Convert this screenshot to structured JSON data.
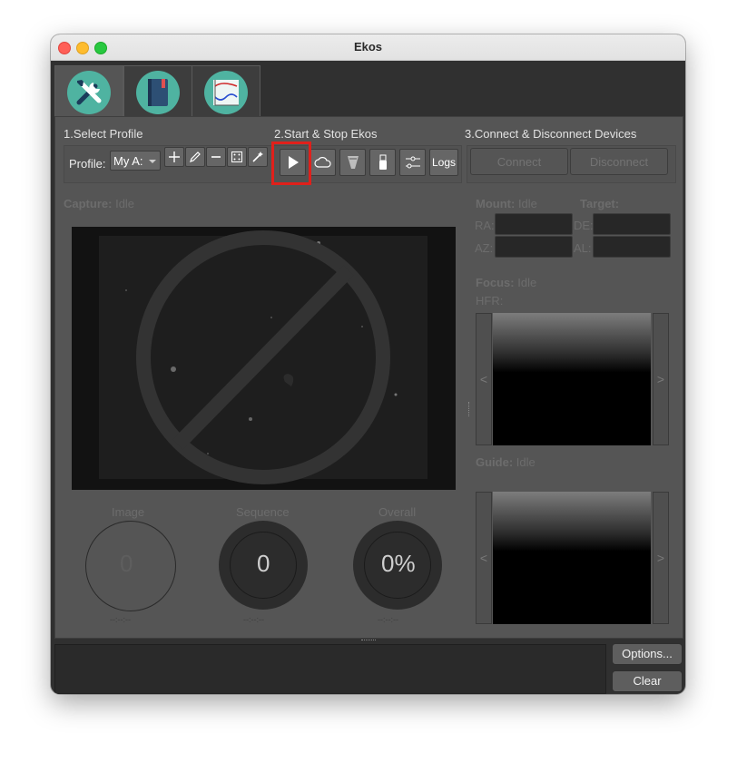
{
  "window": {
    "title": "Ekos"
  },
  "tabs": [
    {
      "icon": "tools-icon",
      "active": true
    },
    {
      "icon": "notebook-icon",
      "active": false
    },
    {
      "icon": "analyze-chart-icon",
      "active": false
    }
  ],
  "sections": {
    "profile": "1.Select Profile",
    "start_stop": "2.Start & Stop Ekos",
    "connect": "3.Connect & Disconnect Devices"
  },
  "profile": {
    "label": "Profile:",
    "selected": "My A:",
    "buttons": [
      "add-icon",
      "edit-icon",
      "remove-icon",
      "dice-icon",
      "wand-icon"
    ]
  },
  "start_stop": {
    "buttons": [
      "play-icon",
      "cloud-icon",
      "telescope-icon",
      "usb-icon",
      "settings-sliders-icon"
    ],
    "logs_label": "Logs"
  },
  "connect": {
    "connect_label": "Connect",
    "disconnect_label": "Disconnect"
  },
  "capture": {
    "label": "Capture:",
    "status": "Idle"
  },
  "mount": {
    "label": "Mount:",
    "status": "Idle",
    "target_label": "Target:",
    "ra": "RA:",
    "de": "DE:",
    "az": "AZ:",
    "al": "AL:"
  },
  "focus": {
    "label": "Focus:",
    "status": "Idle",
    "hfr": "HFR:"
  },
  "guide": {
    "label": "Guide:",
    "status": "Idle"
  },
  "progress": {
    "image": {
      "label": "Image",
      "value": "0",
      "time": "--:--:--"
    },
    "sequence": {
      "label": "Sequence",
      "value": "0",
      "time": "--:--:--"
    },
    "overall": {
      "label": "Overall",
      "value": "0%",
      "time": "--:--:--"
    }
  },
  "nav": {
    "left": "<",
    "right": ">"
  },
  "footer": {
    "options_label": "Options...",
    "clear_label": "Clear"
  },
  "colors": {
    "highlight": "#e0201b",
    "panel": "#555555"
  }
}
